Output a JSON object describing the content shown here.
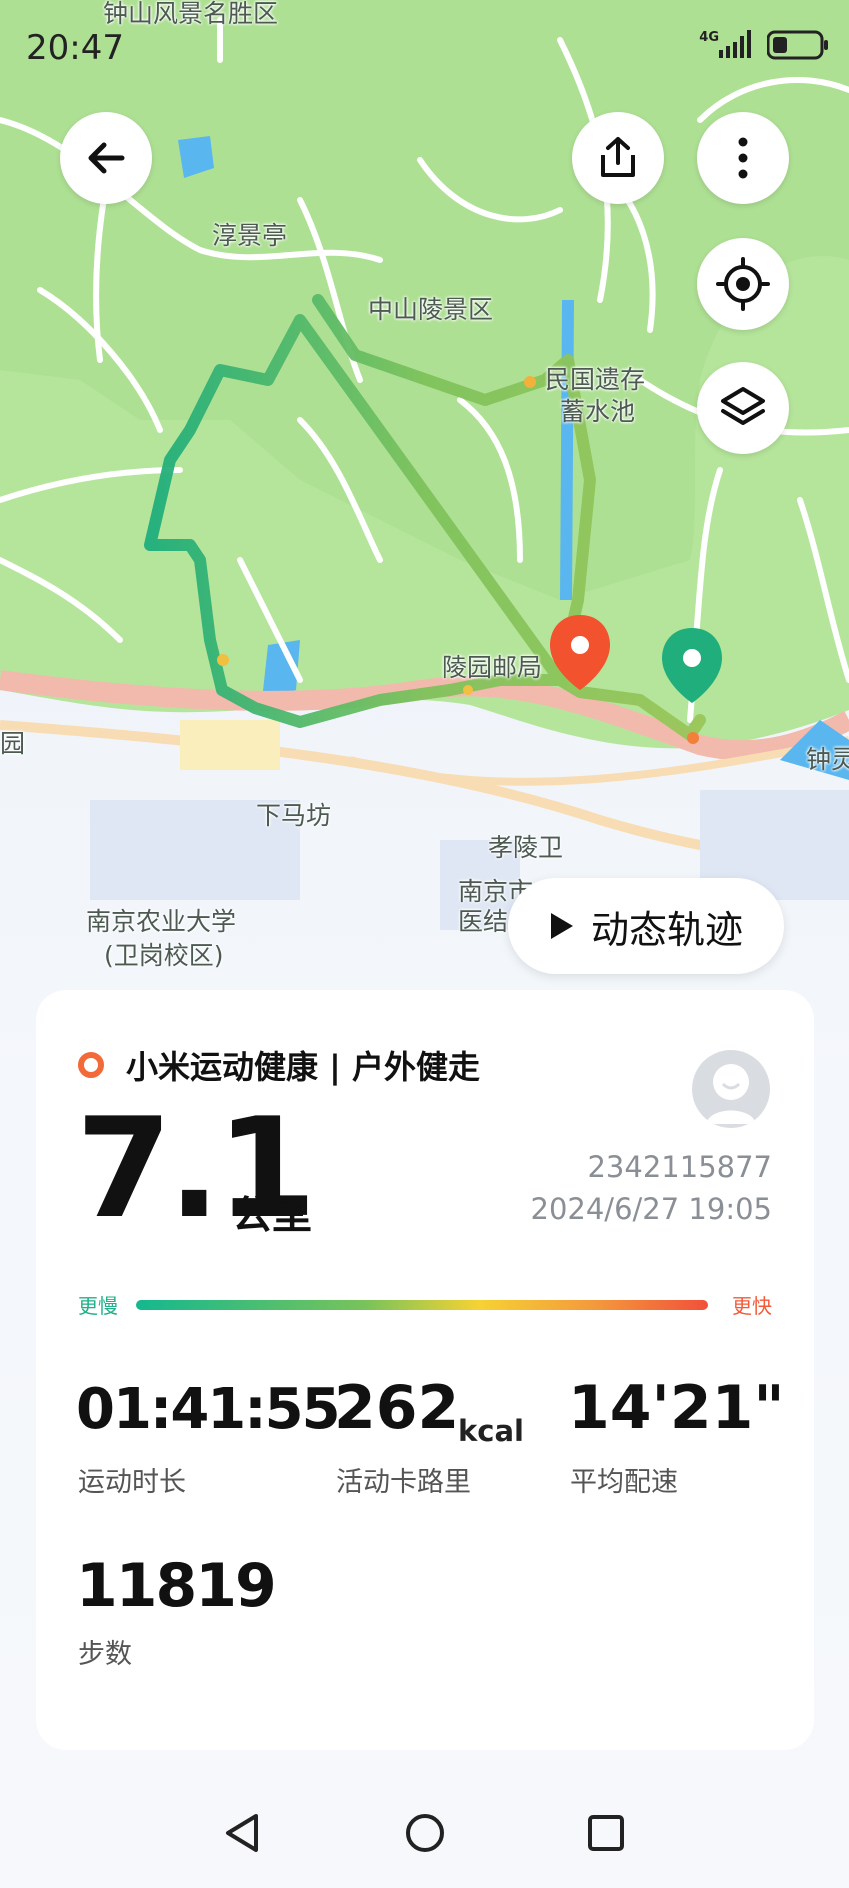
{
  "status_bar": {
    "time": "20:47",
    "network": "4G"
  },
  "map": {
    "labels": {
      "zhongshan_scenic": "钟山风景名胜区",
      "chunjing_pavilion": "淳景亭",
      "zhongshan_tomb": "中山陵景区",
      "minguo_1": "民国遗存",
      "minguo_2": "蓄水池",
      "lingyuan_post": "陵园邮局",
      "xiamafang": "下马坊",
      "xiaolingwei": "孝陵卫",
      "njau_1": "南京农业大学",
      "njau_2": "(卫岗校区)",
      "nanjing_hosp_1": "南京市",
      "nanjing_hosp_2": "医结",
      "edge_yuan": "园",
      "edge_zhong": "钟灵"
    },
    "play_button_label": "动态轨迹",
    "colors": {
      "route_start": "#1fb37a",
      "route_end": "#f26a3a"
    }
  },
  "toolbar": {
    "back_icon": "arrow-left-icon",
    "share_icon": "share-icon",
    "more_icon": "more-vertical-icon",
    "locate_icon": "locate-target-icon",
    "layers_icon": "layers-icon"
  },
  "workout": {
    "app_title": "小米运动健康 | 户外健走",
    "distance": "7.1",
    "distance_unit": "公里",
    "user_id": "2342115877",
    "datetime": "2024/6/27 19:05",
    "pace_slow_label": "更慢",
    "pace_fast_label": "更快",
    "stats": {
      "duration_value": "01:41:55",
      "duration_label": "运动时长",
      "calories_value": "262",
      "calories_unit": "kcal",
      "calories_label": "活动卡路里",
      "pace_value": "14'21\"",
      "pace_label": "平均配速",
      "steps_value": "11819",
      "steps_label": "步数"
    }
  },
  "nav": {
    "back": "triangle-back-icon",
    "home": "circle-home-icon",
    "recent": "square-recents-icon"
  }
}
